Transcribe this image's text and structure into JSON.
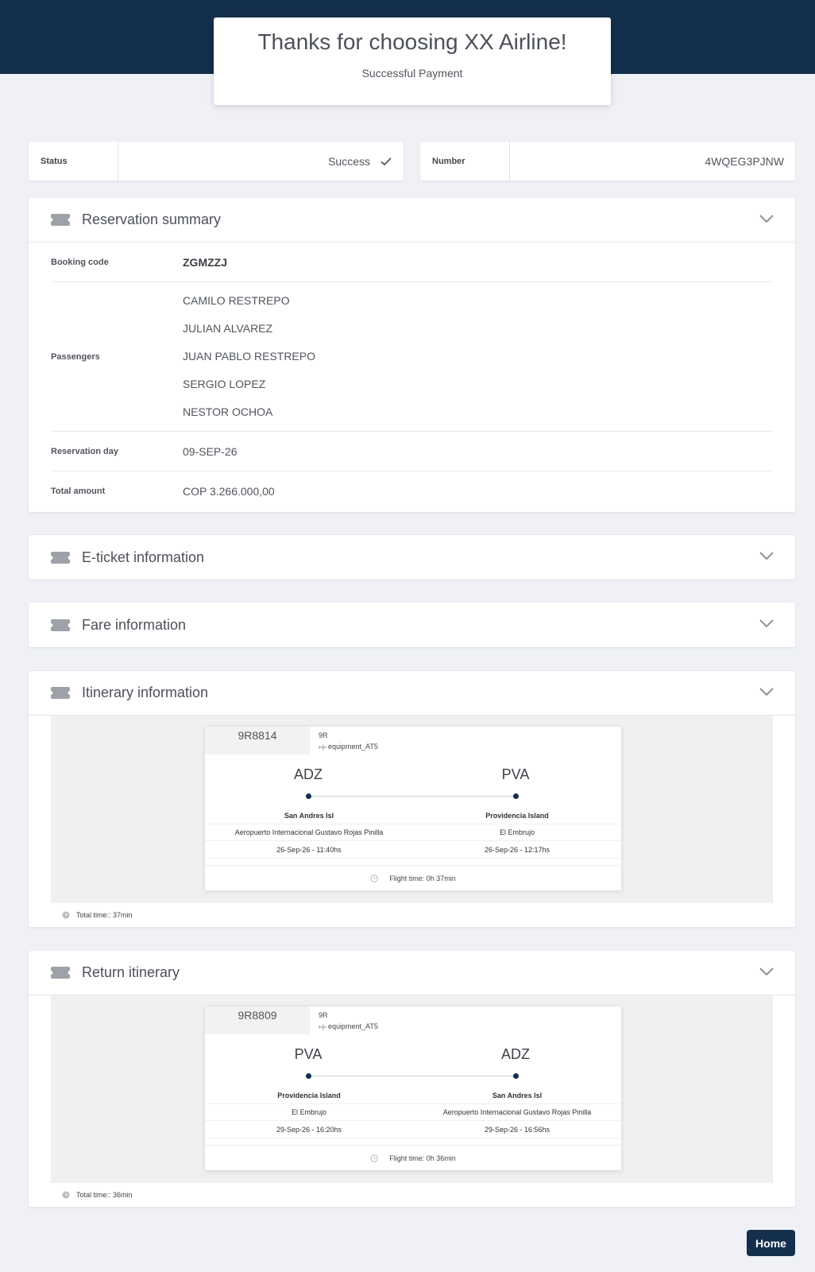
{
  "header": {
    "title": "Thanks for choosing XX Airline!",
    "subtitle": "Successful Payment"
  },
  "status": {
    "label": "Status",
    "value": "Success"
  },
  "number": {
    "label": "Number",
    "value": "4WQEG3PJNW"
  },
  "reservation_summary": {
    "title": "Reservation summary",
    "booking_code_label": "Booking code",
    "booking_code": "ZGMZZJ",
    "passengers_label": "Passengers",
    "passengers": [
      "CAMILO RESTREPO",
      "JULIAN ALVAREZ",
      "JUAN PABLO RESTREPO",
      "SERGIO LOPEZ",
      "NESTOR OCHOA"
    ],
    "reservation_day_label": "Reservation day",
    "reservation_day": "09-SEP-26",
    "total_amount_label": "Total amount",
    "total_amount": "COP 3.266.000,00"
  },
  "eticket": {
    "title": "E-ticket information"
  },
  "fare": {
    "title": "Fare information"
  },
  "itinerary": {
    "title": "Itinerary information",
    "flight": {
      "number": "9R8814",
      "carrier": "9R",
      "equipment": "equipment_AT5",
      "origin": {
        "code": "ADZ",
        "city": "San Andres Isl",
        "airport": "Aeropuerto Internacional Gustavo Rojas Pinilla",
        "datetime": "26-Sep-26 - 11:40hs"
      },
      "destination": {
        "code": "PVA",
        "city": "Providencia Island",
        "airport": "El Embrujo",
        "datetime": "26-Sep-26 - 12:17hs"
      },
      "flight_time": "Flight time: 0h 37min"
    },
    "total_time": "Total time:: 37min"
  },
  "return_itinerary": {
    "title": "Return itinerary",
    "flight": {
      "number": "9R8809",
      "carrier": "9R",
      "equipment": "equipment_AT5",
      "origin": {
        "code": "PVA",
        "city": "Providencia Island",
        "airport": "El Embrujo",
        "datetime": "29-Sep-26 - 16:20hs"
      },
      "destination": {
        "code": "ADZ",
        "city": "San Andres Isl",
        "airport": "Aeropuerto Internacional Gustavo Rojas Pinilla",
        "datetime": "29-Sep-26 - 16:56hs"
      },
      "flight_time": "Flight time: 0h 36min"
    },
    "total_time": "Total time:: 36min"
  },
  "footer": {
    "home_label": "Home"
  },
  "colors": {
    "navy": "#142f4c",
    "background": "#eff1f6",
    "text": "#50555c"
  },
  "icons": [
    "check-icon",
    "ticket-icon",
    "chevron-down-icon",
    "plane-icon",
    "clock-icon"
  ]
}
